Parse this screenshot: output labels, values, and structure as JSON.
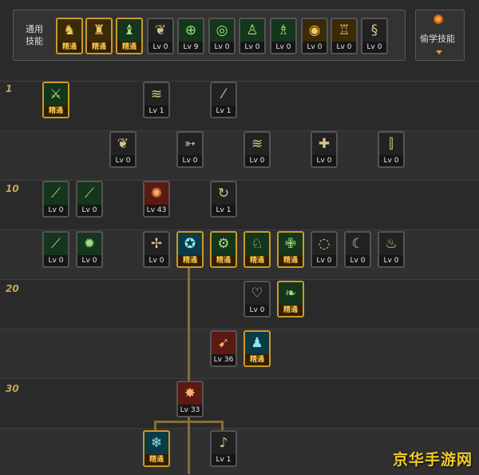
{
  "common_skills": {
    "label_line1": "通用",
    "label_line2": "技能",
    "items": [
      {
        "icon": "sitting-figure-icon",
        "label": "精通",
        "state": "mastered"
      },
      {
        "icon": "running-figure-icon",
        "label": "精通",
        "state": "mastered"
      },
      {
        "icon": "leap-figure-icon",
        "label": "精通",
        "state": "mastered"
      },
      {
        "icon": "wings-icon",
        "label": "Lv 0",
        "state": "level"
      },
      {
        "icon": "crosshair-icon",
        "label": "Lv 9",
        "state": "level"
      },
      {
        "icon": "target-icon",
        "label": "Lv 0",
        "state": "level"
      },
      {
        "icon": "figure-icon",
        "label": "Lv 0",
        "state": "level"
      },
      {
        "icon": "figure-swing-icon",
        "label": "Lv 0",
        "state": "level"
      },
      {
        "icon": "eye-icon",
        "label": "Lv 0",
        "state": "level"
      },
      {
        "icon": "armor-icon",
        "label": "Lv 0",
        "state": "level"
      },
      {
        "icon": "scroll-icon",
        "label": "Lv 0",
        "state": "level"
      }
    ]
  },
  "steal_skills": {
    "label": "偷学技能",
    "icon": "orb-icon"
  },
  "tree": {
    "level_markers": [
      "1",
      "10",
      "20",
      "30"
    ],
    "skills": [
      {
        "icon": "sword-shield-icon",
        "label": "精通",
        "state": "mastered"
      },
      {
        "icon": "claw-icon",
        "label": "Lv 1",
        "state": "level"
      },
      {
        "icon": "slash-icon",
        "label": "Lv 1",
        "state": "level"
      },
      {
        "icon": "wings-icon",
        "label": "Lv 0",
        "state": "level"
      },
      {
        "icon": "arrow-right-icon",
        "label": "Lv 0",
        "state": "level"
      },
      {
        "icon": "claw-icon",
        "label": "Lv 0",
        "state": "level"
      },
      {
        "icon": "cross-shield-icon",
        "label": "Lv 0",
        "state": "level"
      },
      {
        "icon": "triple-blade-icon",
        "label": "Lv 0",
        "state": "level"
      },
      {
        "icon": "blade-icon",
        "label": "Lv 0",
        "state": "level"
      },
      {
        "icon": "blade-icon",
        "label": "Lv 0",
        "state": "level"
      },
      {
        "icon": "fire-burst-icon",
        "label": "Lv 43",
        "state": "level"
      },
      {
        "icon": "spin-icon",
        "label": "Lv 1",
        "state": "level"
      },
      {
        "icon": "blade-icon",
        "label": "Lv 0",
        "state": "level"
      },
      {
        "icon": "star-burst-icon",
        "label": "Lv 0",
        "state": "level"
      },
      {
        "icon": "cross-sword-icon",
        "label": "Lv 0",
        "state": "level"
      },
      {
        "icon": "rune-circle-icon",
        "label": "精通",
        "state": "mastered"
      },
      {
        "icon": "gear-icon",
        "label": "精通",
        "state": "mastered"
      },
      {
        "icon": "strength-icon",
        "label": "精通",
        "state": "mastered"
      },
      {
        "icon": "plus-cross-icon",
        "label": "精通",
        "state": "mastered"
      },
      {
        "icon": "swirl-icon",
        "label": "Lv 0",
        "state": "level"
      },
      {
        "icon": "crescent-icon",
        "label": "Lv 0",
        "state": "level"
      },
      {
        "icon": "flame-icon",
        "label": "Lv 0",
        "state": "level"
      },
      {
        "icon": "heart-icon",
        "label": "Lv 0",
        "state": "level"
      },
      {
        "icon": "leaf-icon",
        "label": "精通",
        "state": "mastered"
      },
      {
        "icon": "red-dash-icon",
        "label": "Lv 36",
        "state": "level"
      },
      {
        "icon": "blue-figure-icon",
        "label": "精通",
        "state": "mastered"
      },
      {
        "icon": "explosion-icon",
        "label": "Lv 33",
        "state": "level"
      },
      {
        "icon": "ice-icon",
        "label": "精通",
        "state": "mastered"
      },
      {
        "icon": "horn-icon",
        "label": "Lv 1",
        "state": "level"
      }
    ]
  },
  "watermark": "京华手游网"
}
